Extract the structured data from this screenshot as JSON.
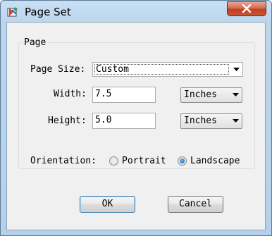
{
  "window": {
    "title": "Page Set",
    "close_symbol": "✕"
  },
  "group": {
    "label": "Page"
  },
  "page_size": {
    "label": "Page Size:",
    "value": "Custom"
  },
  "width": {
    "label": "Width:",
    "value": "7.5",
    "unit": "Inches"
  },
  "height": {
    "label": "Height:",
    "value": "5.0",
    "unit": "Inches"
  },
  "orientation": {
    "label": "Orientation:",
    "options": [
      "Portrait",
      "Landscape"
    ],
    "selected": "Landscape"
  },
  "buttons": {
    "ok": "OK",
    "cancel": "Cancel"
  },
  "colors": {
    "close_red": "#c23f1f",
    "title_bg": "#bcd6ee",
    "client_bg": "#f0f0f0"
  },
  "icons": {
    "app": "page-set-app-icon",
    "close": "close-icon",
    "dropdown": "chevron-down-icon"
  }
}
